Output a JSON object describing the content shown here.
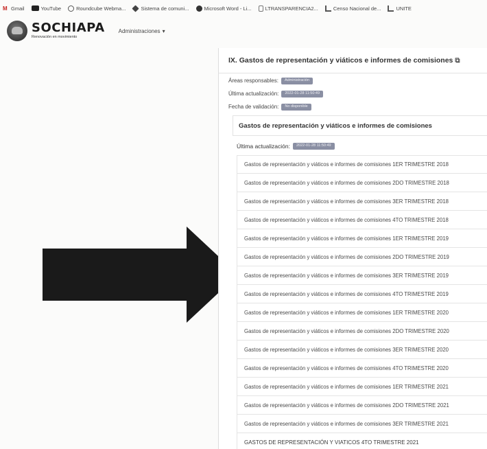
{
  "bookmarks": [
    {
      "label": "Gmail",
      "icon": "gmail-icon",
      "color": "#c5221f"
    },
    {
      "label": "YouTube",
      "icon": "youtube-icon",
      "color": "#222222"
    },
    {
      "label": "Roundcube Webma...",
      "icon": "roundcube-icon",
      "color": "#555555"
    },
    {
      "label": "Sistema de comuni...",
      "icon": "diamond-icon",
      "color": "#444444"
    },
    {
      "label": "Microsoft Word - Li...",
      "icon": "globe-icon",
      "color": "#333333"
    },
    {
      "label": "LTRANSPARENCIA2...",
      "icon": "document-icon",
      "color": "#666666"
    },
    {
      "label": "Censo Nacional de...",
      "icon": "chart-icon",
      "color": "#555555"
    },
    {
      "label": "UNITE",
      "icon": "chart-icon",
      "color": "#555555"
    }
  ],
  "header": {
    "logo_title": "SOCHIAPA",
    "logo_subtitle": "Renovación en movimiento",
    "menu_label": "Administraciones",
    "menu_caret": "▾"
  },
  "panel": {
    "title": "IX. Gastos de representación y viáticos e informes de comisiones",
    "title_icon": "external-link-icon",
    "meta": {
      "areas_label": "Áreas responsables:",
      "areas_badge": "Administración",
      "updated_label": "Última actualización:",
      "updated_badge": "2022-01-28 11:50:49",
      "validation_label": "Fecha de validación:",
      "validation_badge": "No disponible"
    },
    "section": {
      "title": "Gastos de representación y viáticos e informes de comisiones",
      "updated_label": "Última actualización:",
      "updated_badge": "2022-01-28 11:50:49"
    },
    "documents": [
      "Gastos de representación y viáticos e informes de comisiones 1ER TRIMESTRE 2018",
      "Gastos de representación y viáticos e informes de comisiones 2DO TRIMESTRE 2018",
      "Gastos de representación y viáticos e informes de comisiones 3ER TRIMESTRE 2018",
      "Gastos de representación y viáticos e informes de comisiones 4TO TRIMESTRE 2018",
      "Gastos de representación y viáticos e informes de comisiones 1ER TRIMESTRE 2019",
      "Gastos de representación y viáticos e informes de comisiones 2DO TRIMESTRE 2019",
      "Gastos de representación y viáticos e informes de comisiones 3ER TRIMESTRE 2019",
      "Gastos de representación y viáticos e informes de comisiones 4TO TRIMESTRE 2019",
      "Gastos de representación y viáticos e informes de comisiones 1ER TRIMESTRE 2020",
      "Gastos de representación y viáticos e informes de comisiones 2DO TRIMESTRE 2020",
      "Gastos de representación y viáticos e informes de comisiones 3ER TRIMESTRE 2020",
      "Gastos de representación y viáticos e informes de comisiones 4TO TRIMESTRE 2020",
      "Gastos de representación y viáticos e informes de comisiones 1ER TRIMESTRE 2021",
      "Gastos de representación y viáticos e informes de comisiones 2DO TRIMESTRE 2021",
      "Gastos de representación y viáticos e informes de comisiones 3ER TRIMESTRE 2021",
      "GASTOS DE REPRESENTACIÓN Y VIATICOS 4TO TRIMESTRE 2021"
    ]
  },
  "arrow": {
    "color": "#1a1a1a",
    "icon": "arrow-right-icon"
  }
}
